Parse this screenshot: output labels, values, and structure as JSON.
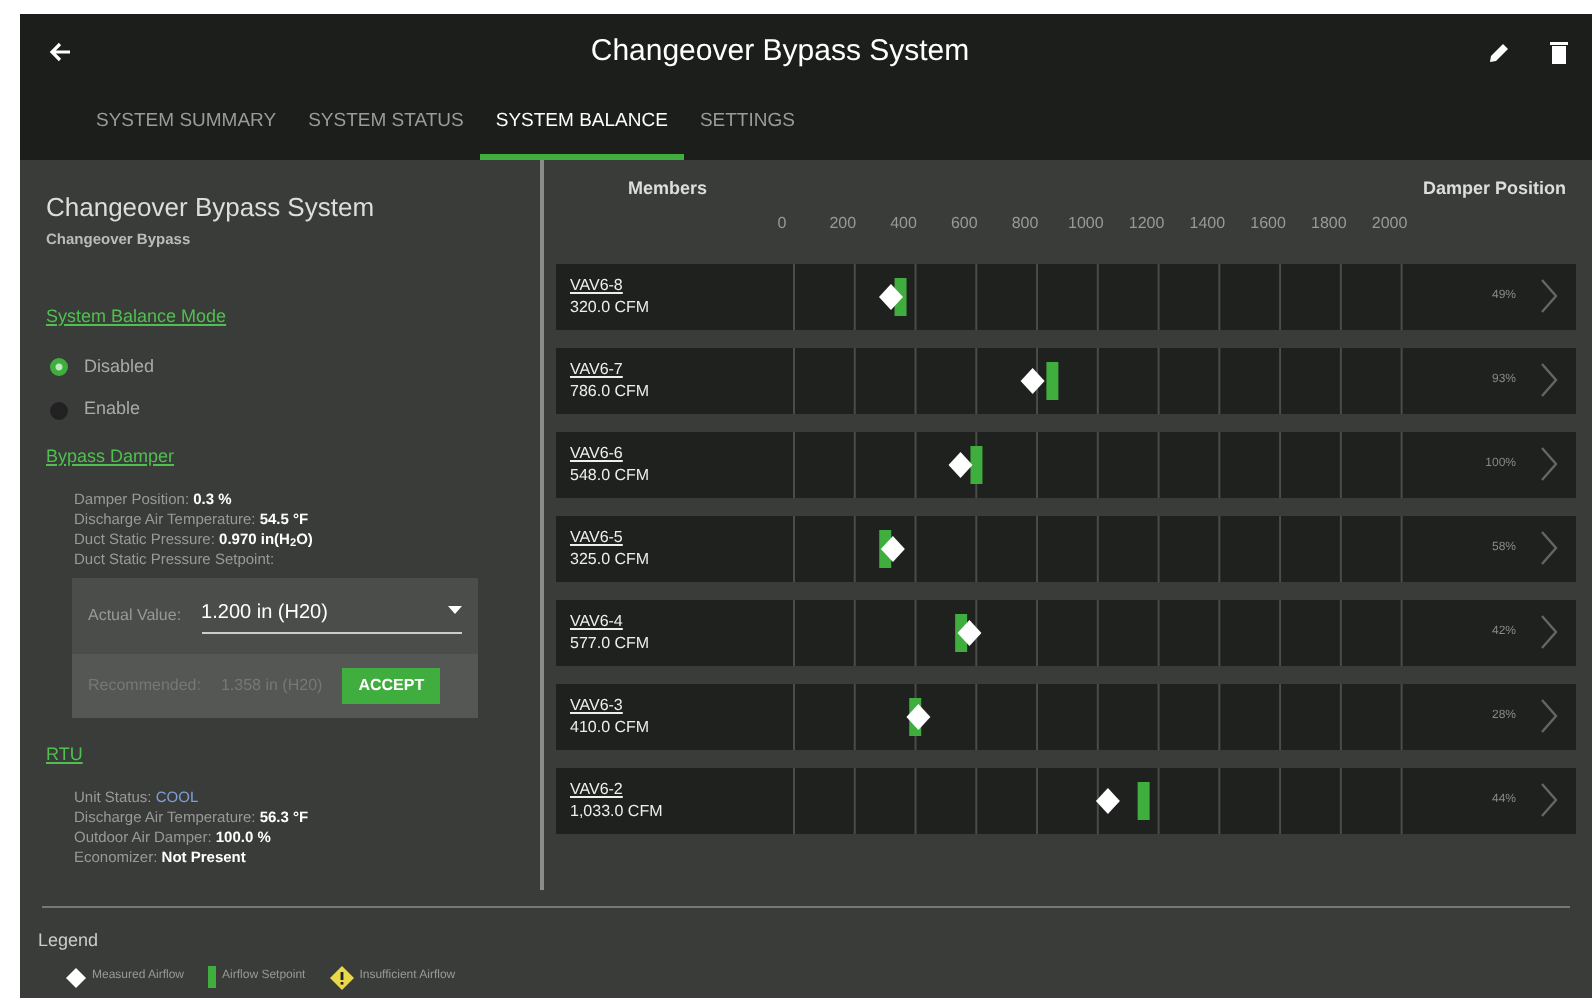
{
  "header": {
    "title": "Changeover Bypass System"
  },
  "tabs": [
    {
      "label": "SYSTEM SUMMARY",
      "selected": false
    },
    {
      "label": "SYSTEM STATUS",
      "selected": false
    },
    {
      "label": "SYSTEM BALANCE",
      "selected": true
    },
    {
      "label": "SETTINGS",
      "selected": false
    }
  ],
  "system": {
    "title": "Changeover Bypass System",
    "subtitle": "Changeover Bypass"
  },
  "balance_mode": {
    "heading": "System Balance Mode",
    "options": [
      {
        "label": "Disabled",
        "selected": true
      },
      {
        "label": "Enable",
        "selected": false
      }
    ]
  },
  "bypass_damper": {
    "heading": "Bypass Damper",
    "readings": [
      {
        "label": "Damper Position:",
        "value": "0.3 %",
        "kind": "reading"
      },
      {
        "label": "Discharge Air Temperature:",
        "value": "54.5 °F",
        "kind": "reading"
      },
      {
        "label": "Duct Static Pressure:",
        "value": "0.970 in(H$_{2}$O)",
        "kind": "reading"
      },
      {
        "label": "Duct Static Pressure Setpoint:",
        "kind": "reading"
      }
    ],
    "setpoint": {
      "actual_label": "Actual Value:",
      "actual_value": "1.200 in (H20)",
      "recommended_label": "Recommended:",
      "recommended_value": "1.358 in (H20)",
      "accept": "ACCEPT"
    }
  },
  "rtu": {
    "heading": "RTU",
    "readings": [
      {
        "label": "Unit Status:",
        "value": "COOL",
        "kind": "status"
      },
      {
        "label": "Discharge Air Temperature:",
        "value": "56.3 °F",
        "kind": "reading"
      },
      {
        "label": "Outdoor Air Damper:",
        "value": "100.0 %",
        "kind": "reading"
      },
      {
        "label": "Economizer:",
        "value": "Not Present",
        "kind": "reading"
      }
    ]
  },
  "members": {
    "heading": "Members",
    "damper_heading": "Damper Position",
    "axis_labels": [
      "0",
      "200",
      "400",
      "600",
      "800",
      "1000",
      "1200",
      "1400",
      "1600",
      "1800",
      "2000"
    ],
    "rows": [
      {
        "name": "VAV6-8",
        "flow": "320.0 CFM",
        "damper": "49%",
        "measured": {
          "level": 0.152
        },
        "setpoint": {
          "level": 0.167
        }
      },
      {
        "name": "VAV6-7",
        "flow": "786.0 CFM",
        "damper": "93%",
        "measured": {
          "level": 0.374
        },
        "setpoint": {
          "level": 0.405
        }
      },
      {
        "name": "VAV6-6",
        "flow": "548.0 CFM",
        "damper": "100%",
        "measured": {
          "level": 0.261
        },
        "setpoint": {
          "level": 0.286
        }
      },
      {
        "name": "VAV6-5",
        "flow": "325.0 CFM",
        "damper": "58%",
        "measured": {
          "level": 0.155
        },
        "setpoint": {
          "level": 0.143
        }
      },
      {
        "name": "VAV6-4",
        "flow": "577.0 CFM",
        "damper": "42%",
        "measured": {
          "level": 0.275
        },
        "setpoint": {
          "level": 0.262
        }
      },
      {
        "name": "VAV6-3",
        "flow": "410.0 CFM",
        "damper": "28%",
        "measured": {
          "level": 0.195
        },
        "setpoint": {
          "level": 0.19
        }
      },
      {
        "name": "VAV6-2",
        "flow": "1,033.0 CFM",
        "damper": "44%",
        "measured": {
          "level": 0.492
        },
        "setpoint": {
          "level": 0.548
        }
      }
    ]
  },
  "legend": {
    "title": "Legend",
    "items": [
      {
        "label": "Measured Airflow",
        "kind": "measured"
      },
      {
        "label": "Airflow Setpoint",
        "kind": "setpoint"
      },
      {
        "label": "Insufficient Airflow",
        "kind": "insufficient"
      }
    ]
  }
}
